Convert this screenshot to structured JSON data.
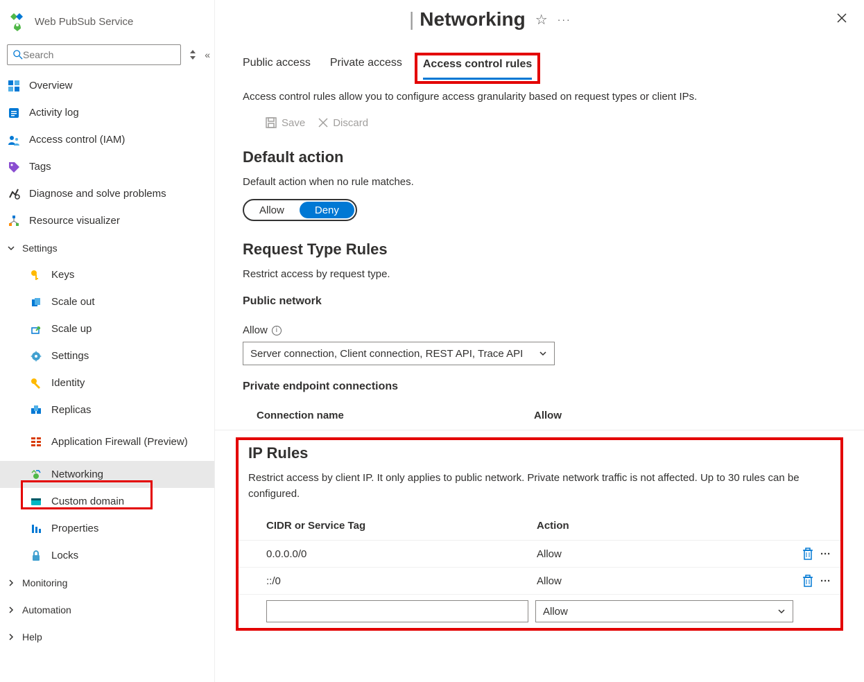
{
  "brand": {
    "name": "Web PubSub Service"
  },
  "search": {
    "placeholder": "Search"
  },
  "nav": {
    "overview": "Overview",
    "activity": "Activity log",
    "iam": "Access control (IAM)",
    "tags": "Tags",
    "diagnose": "Diagnose and solve problems",
    "visualizer": "Resource visualizer",
    "settings": "Settings",
    "keys": "Keys",
    "scaleout": "Scale out",
    "scaleup": "Scale up",
    "settingsItem": "Settings",
    "identity": "Identity",
    "replicas": "Replicas",
    "firewall": "Application Firewall (Preview)",
    "networking": "Networking",
    "customdomain": "Custom domain",
    "properties": "Properties",
    "locks": "Locks",
    "monitoring": "Monitoring",
    "automation": "Automation",
    "help": "Help"
  },
  "header": {
    "title": "Networking"
  },
  "tabs": {
    "public": "Public access",
    "private": "Private access",
    "acr": "Access control rules"
  },
  "description": "Access control rules allow you to configure access granularity based on request types or client IPs.",
  "toolbar": {
    "save": "Save",
    "discard": "Discard"
  },
  "default_action": {
    "title": "Default action",
    "subtitle": "Default action when no rule matches.",
    "allow": "Allow",
    "deny": "Deny"
  },
  "request_rules": {
    "title": "Request Type Rules",
    "subtitle": "Restrict access by request type.",
    "public_network": "Public network",
    "allow_label": "Allow",
    "dropdown_value": "Server connection, Client connection, REST API, Trace API",
    "private_endpoint": "Private endpoint connections",
    "col_conn": "Connection name",
    "col_allow": "Allow"
  },
  "ip_rules": {
    "title": "IP Rules",
    "desc": "Restrict access by client IP. It only applies to public network. Private network traffic is not affected. Up to 30 rules can be configured.",
    "col_cidr": "CIDR or Service Tag",
    "col_action": "Action",
    "rows": [
      {
        "cidr": "0.0.0.0/0",
        "action": "Allow"
      },
      {
        "cidr": "::/0",
        "action": "Allow"
      }
    ],
    "new_action": "Allow"
  }
}
